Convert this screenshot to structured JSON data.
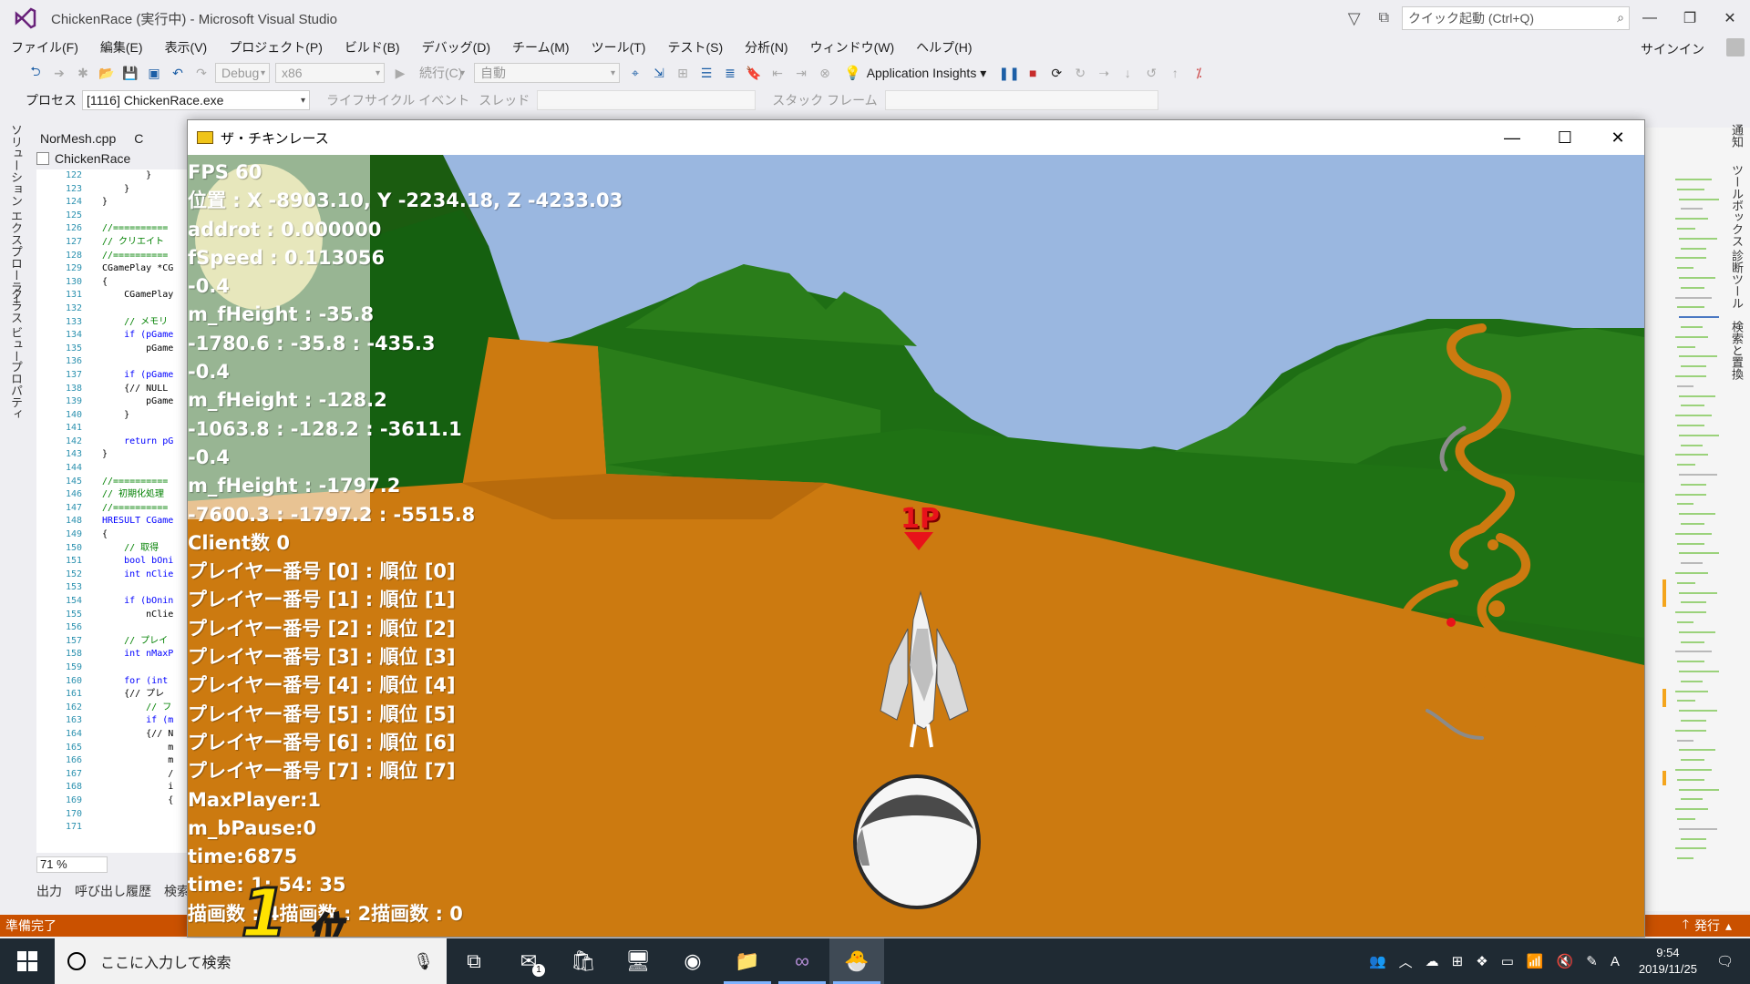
{
  "vs": {
    "title": "ChickenRace (実行中) - Microsoft Visual Studio",
    "quick_launch": "クイック起動 (Ctrl+Q)",
    "signin": "サインイン",
    "menu": [
      "ファイル(F)",
      "編集(E)",
      "表示(V)",
      "プロジェクト(P)",
      "ビルド(B)",
      "デバッグ(D)",
      "チーム(M)",
      "ツール(T)",
      "テスト(S)",
      "分析(N)",
      "ウィンドウ(W)",
      "ヘルプ(H)"
    ],
    "toolbar": {
      "config": "Debug",
      "platform": "x86",
      "continue": "続行(C)",
      "auto": "自動",
      "app_insights": "Application Insights"
    },
    "toolbar2": {
      "process_label": "プロセス",
      "process_value": "[1116] ChickenRace.exe",
      "lifecycle": "ライフサイクル イベント",
      "thread": "スレッド",
      "stack_frame": "スタック フレーム"
    },
    "left_tabs": [
      "ソリューション エクスプローラー",
      "クラス ビュー",
      "プロパティ"
    ],
    "right_tabs": [
      "通知",
      "ツールボックス",
      "診断ツール",
      "検索と置換"
    ],
    "doc_tab": "NorMesh.cpp",
    "doc_tab2": "C",
    "doc_sub": "ChickenRace",
    "line_numbers": [
      "122",
      "123",
      "124",
      "125",
      "126",
      "127",
      "128",
      "129",
      "130",
      "131",
      "132",
      "133",
      "134",
      "135",
      "136",
      "137",
      "138",
      "139",
      "140",
      "141",
      "142",
      "143",
      "144",
      "145",
      "146",
      "147",
      "148",
      "149",
      "150",
      "151",
      "152",
      "153",
      "154",
      "155",
      "156",
      "157",
      "158",
      "159",
      "160",
      "161",
      "162",
      "163",
      "164",
      "165",
      "166",
      "167",
      "168",
      "169",
      "170",
      "171"
    ],
    "code_lines": [
      "        }",
      "    }",
      "}",
      "",
      "//==========",
      "// クリエイト",
      "//==========",
      "CGamePlay *CG",
      "{",
      "    CGamePlay",
      "",
      "    // メモリ",
      "    if (pGame",
      "        pGame",
      "",
      "    if (pGame",
      "    {// NULL",
      "        pGame",
      "    }",
      "",
      "    return pG",
      "}",
      "",
      "//==========",
      "// 初期化処理",
      "//==========",
      "HRESULT CGame",
      "{",
      "    // 取得",
      "    bool bOni",
      "    int nClie",
      "",
      "    if (bOnin",
      "        nClie",
      "",
      "    // プレイ",
      "    int nMaxP",
      "",
      "    for (int",
      "    {// プレ",
      "        // フ",
      "        if (m",
      "        {// N",
      "            m",
      "            m",
      "            /",
      "            i",
      "            {",
      "",
      ""
    ],
    "zoom": "71 %",
    "output_tabs": [
      "出力",
      "呼び出し履歴",
      "検索"
    ],
    "status": "準備完了",
    "publish": "発行"
  },
  "game": {
    "window_title": "ザ・チキンレース",
    "hud_lines": [
      "FPS 60",
      "位置 : X -8903.10, Y -2234.18, Z -4233.03",
      "addrot : 0.000000",
      "fSpeed : 0.113056",
      "-0.4",
      "m_fHeight : -35.8",
      "-1780.6 : -35.8 : -435.3",
      "-0.4",
      "m_fHeight : -128.2",
      "-1063.8 : -128.2 : -3611.1",
      "-0.4",
      "m_fHeight : -1797.2",
      "-7600.3 : -1797.2 : -5515.8",
      "Client数 0",
      "プレイヤー番号 [0] : 順位 [0]",
      "プレイヤー番号 [1] : 順位 [1]",
      "プレイヤー番号 [2] : 順位 [2]",
      "プレイヤー番号 [3] : 順位 [3]",
      "プレイヤー番号 [4] : 順位 [4]",
      "プレイヤー番号 [5] : 順位 [5]",
      "プレイヤー番号 [6] : 順位 [6]",
      "プレイヤー番号 [7] : 順位 [7]",
      "MaxPlayer:1",
      "m_bPause:0",
      "time:6875",
      "time:  1: 54: 35",
      "描画数 : 4描画数 : 2描画数 : 0"
    ],
    "player_label": "1P",
    "rank_number": "1",
    "rank_suffix": "位"
  },
  "taskbar": {
    "search_placeholder": "ここに入力して検索",
    "time": "9:54",
    "date": "2019/11/25",
    "mail_badge": "1",
    "ime": "A"
  },
  "colors": {
    "sky": "#9ab7e0",
    "hill": "#1e6e14",
    "ground": "#cc7a10",
    "status_bar": "#ca5100",
    "taskbar": "#1f2a33"
  }
}
